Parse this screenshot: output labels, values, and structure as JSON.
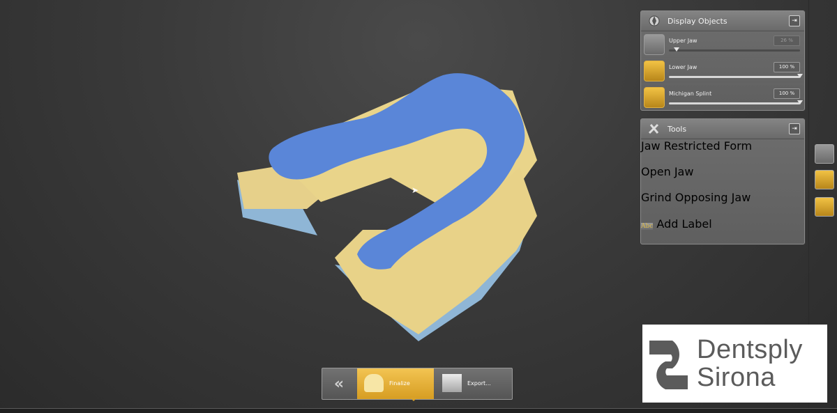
{
  "display_objects": {
    "title": "Display Objects",
    "items": [
      {
        "label": "Upper Jaw",
        "value": "26 %",
        "level": 0.26
      },
      {
        "label": "Lower Jaw",
        "value": "100 %",
        "level": 1.0
      },
      {
        "label": "Michigan Splint",
        "value": "100 %",
        "level": 1.0
      }
    ]
  },
  "tools": {
    "title": "Tools",
    "items": [
      {
        "label": "Jaw Restricted Form"
      },
      {
        "label": "Open Jaw"
      },
      {
        "label": "Grind Opposing Jaw"
      },
      {
        "label": "Add Label"
      }
    ]
  },
  "bottom_bar": {
    "finalize_label": "Finalize",
    "export_label": "Export..."
  },
  "add_label_icon_text": "Abc",
  "logo": {
    "line1": "Dentsply",
    "line2": "Sirona"
  },
  "colors": {
    "model_blue": "#5a86d8",
    "model_yellow": "#e9d48a",
    "model_base": "#8fb6d6",
    "accent_gold": "#e6ae33"
  }
}
